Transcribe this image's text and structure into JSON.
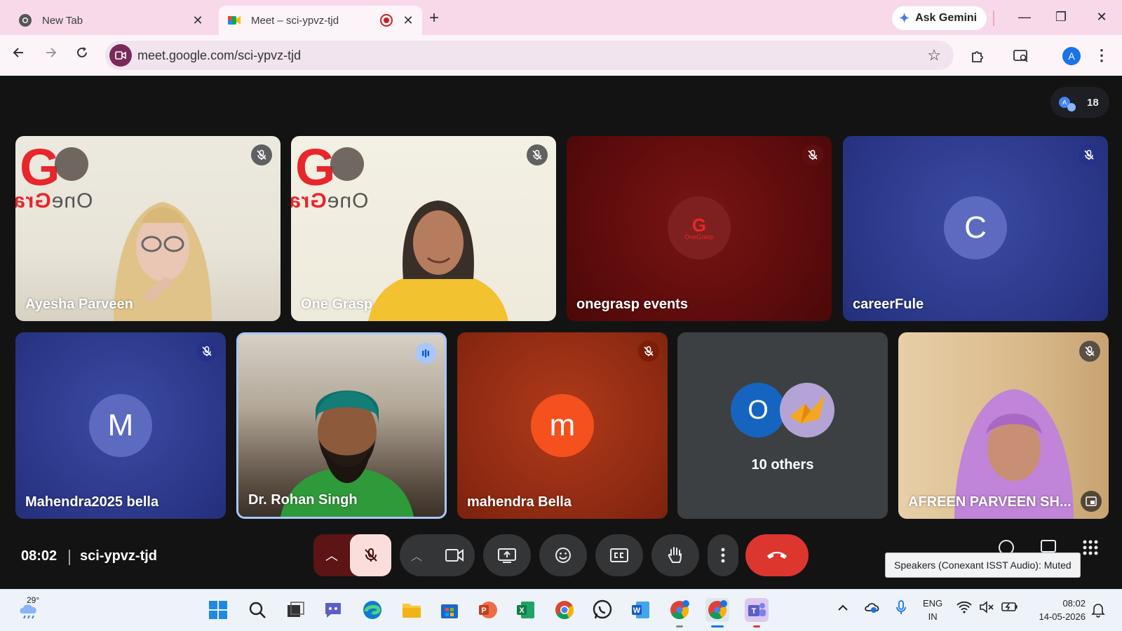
{
  "browser": {
    "tabs": [
      {
        "title": "New Tab",
        "close": "✕",
        "favicon": "chrome-icon"
      },
      {
        "title": "Meet – sci-ypvz-tjd",
        "close": "✕",
        "favicon": "meet-icon",
        "recording": true
      }
    ],
    "new_tab": "+",
    "ask_gemini": "Ask Gemini",
    "window_controls": {
      "minimize": "—",
      "restore": "❐",
      "close": "✕"
    },
    "url": "meet.google.com/sci-ypvz-tjd",
    "profile_initial": "A"
  },
  "meet": {
    "participant_count": "18",
    "tiles": [
      {
        "name": "Ayesha Parveen",
        "muted": true,
        "video": true
      },
      {
        "name": "One Grasp",
        "muted": true,
        "video": true
      },
      {
        "name": "onegrasp events",
        "muted": true,
        "video": false,
        "avatar_label": "OneGrasp"
      },
      {
        "name": "careerFule",
        "muted": true,
        "video": false,
        "avatar_letter": "C"
      },
      {
        "name": "Mahendra2025 bella",
        "muted": true,
        "video": false,
        "avatar_letter": "M"
      },
      {
        "name": "Dr. Rohan Singh",
        "muted": false,
        "speaking": true,
        "video": true
      },
      {
        "name": "mahendra Bella",
        "muted": true,
        "video": false,
        "avatar_letter": "m"
      },
      {
        "name": "10 others",
        "avatar_letter": "O"
      },
      {
        "name": "AFREEN PARVEEN SH...",
        "muted": true,
        "video": true
      }
    ],
    "logo": {
      "letter": "G",
      "text_one": "One",
      "text_grasp": "Gra"
    },
    "clock": "08:02",
    "meeting_code": "sci-ypvz-tjd",
    "tooltip": "Speakers (Conexant ISST Audio): Muted"
  },
  "taskbar": {
    "temperature": "29°",
    "language_line1": "ENG",
    "language_line2": "IN",
    "time": "08:02",
    "date": "14-05-2026"
  },
  "colors": {
    "tabbar": "#f7d9ea",
    "meet_bg": "#131314",
    "leave_red": "#dc362e",
    "mic_muted_bg": "#f9dedc",
    "speaking_border": "#a8c7fa"
  }
}
